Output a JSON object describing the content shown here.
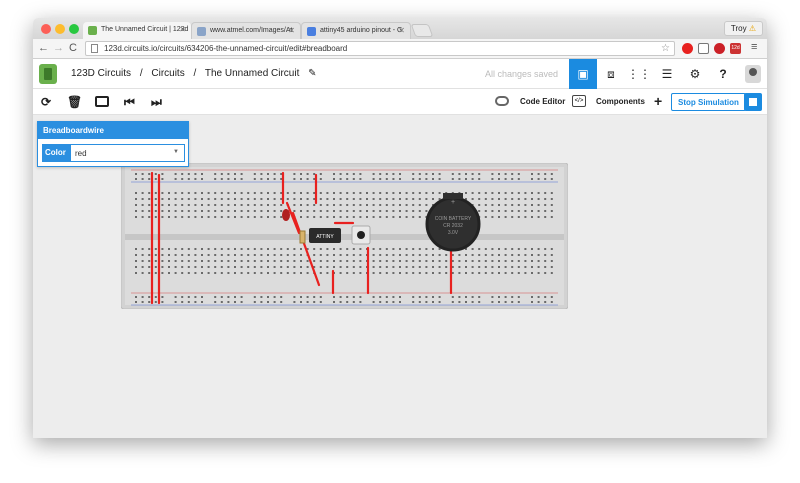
{
  "browser": {
    "tabs": [
      {
        "title": "The Unnamed Circuit | 123d",
        "active": true
      },
      {
        "title": "www.atmel.com/Images/At",
        "active": false
      },
      {
        "title": "attiny45 arduino pinout - G",
        "active": false
      }
    ],
    "user": "Troy",
    "url": "123d.circuits.io/circuits/634206-the-unnamed-circuit/edit#breadboard",
    "ext_badge": "12d"
  },
  "header": {
    "crumbs": [
      "123D Circuits",
      "/",
      "Circuits",
      "/",
      "The Unnamed Circuit"
    ],
    "status": "All changes saved",
    "help": "?"
  },
  "toolbar": {
    "code_editor": "Code Editor",
    "components": "Components",
    "stop_sim": "Stop Simulation",
    "add": "+"
  },
  "inspector": {
    "title": "Breadboardwire",
    "color_label": "Color",
    "color_value": "red"
  },
  "board": {
    "chip_label": "ATTINY",
    "battery_lines": [
      "COIN BATTERY",
      "CR 2032",
      "3.0V"
    ],
    "battery_plus": "+",
    "wire_color": "#e8211f",
    "battery_color": "#333333"
  }
}
